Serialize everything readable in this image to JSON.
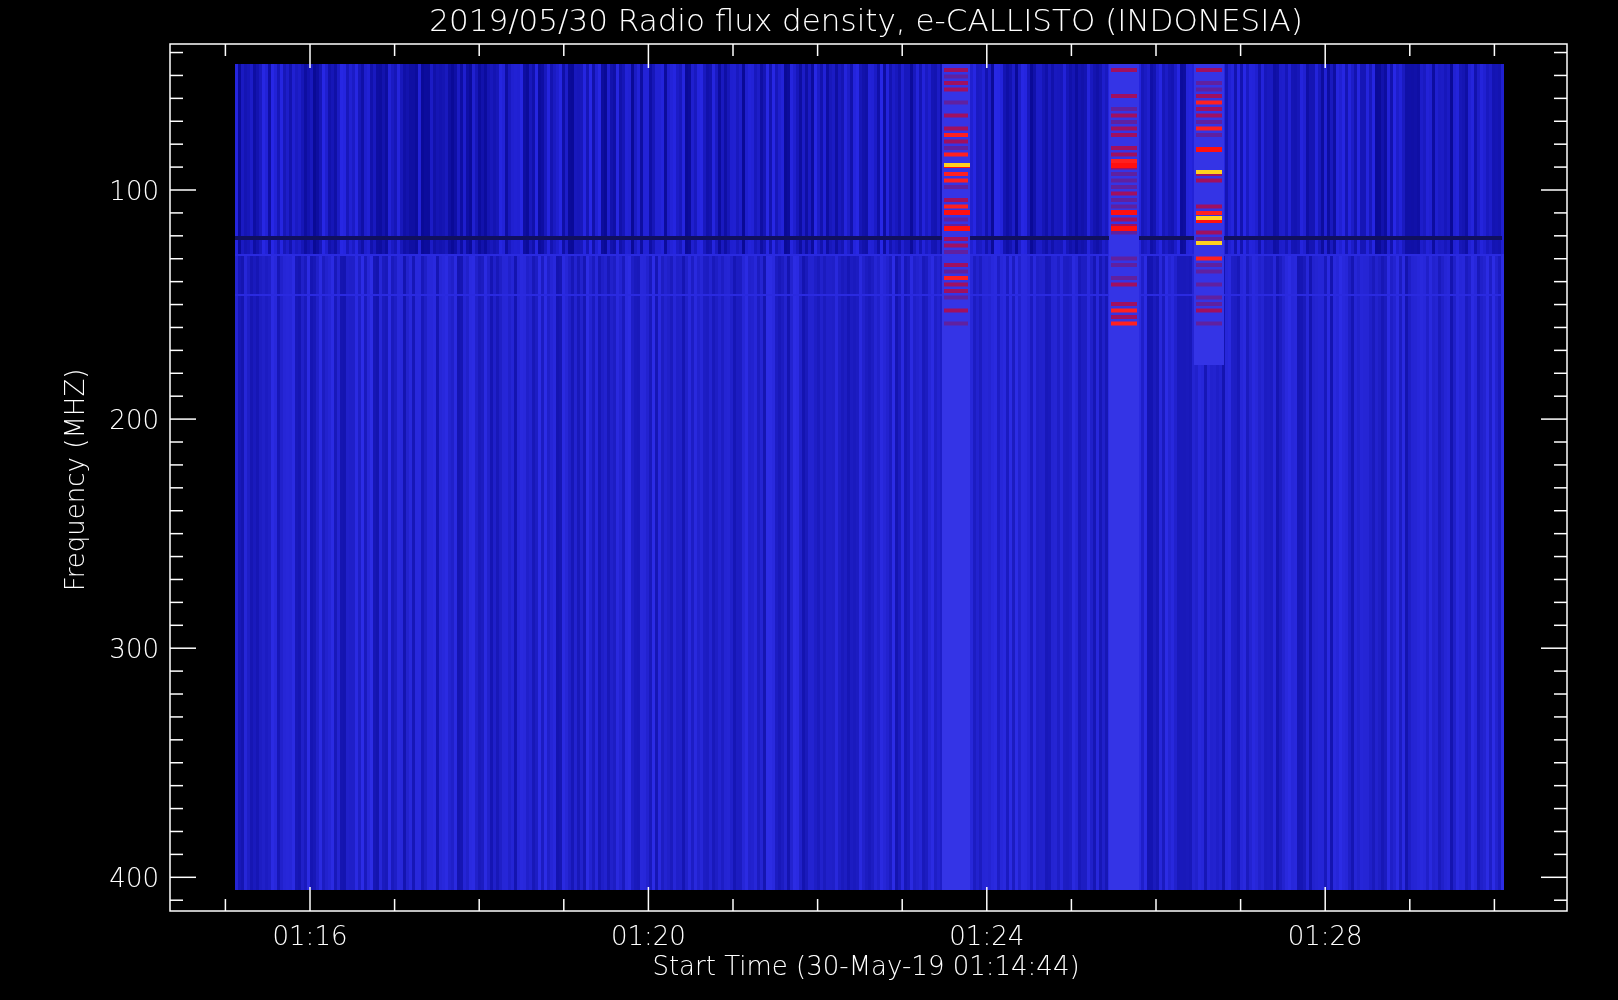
{
  "title": "2019/05/30  Radio flux density, e-CALLISTO (INDONESIA)",
  "y_axis": {
    "label": "Frequency (MHZ)",
    "tick_labels": [
      "100",
      "200",
      "300",
      "400"
    ]
  },
  "x_axis": {
    "label": "Start Time (30-May-19 01:14:44)",
    "tick_labels": [
      "01:16",
      "01:20",
      "01:24",
      "01:28"
    ]
  }
}
